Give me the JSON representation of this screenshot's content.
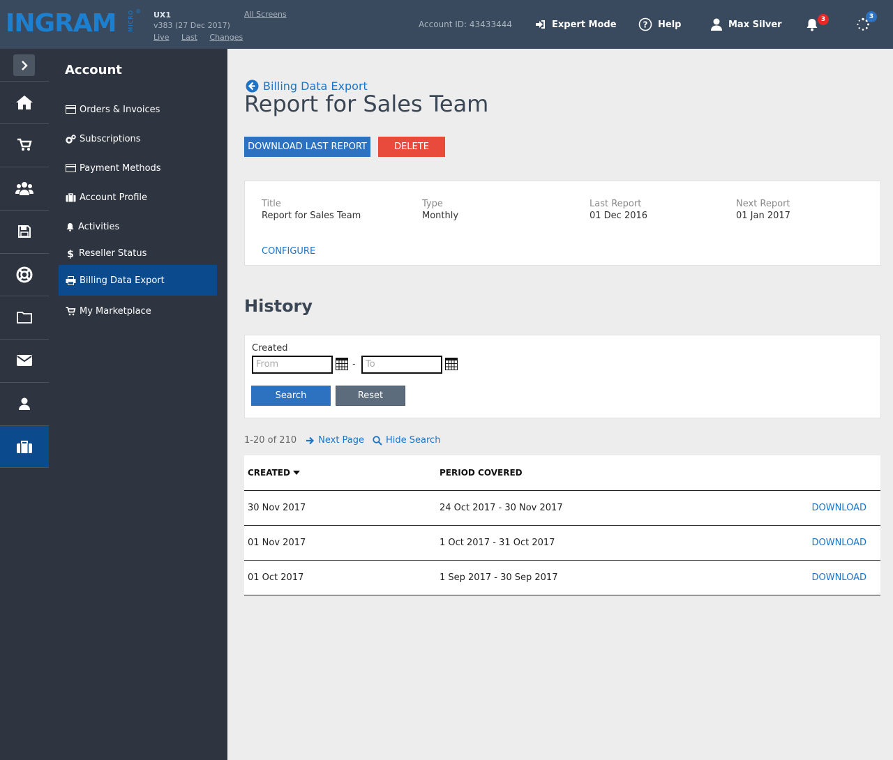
{
  "header": {
    "logo_text": "INGRAM",
    "logo_micro": "MICRO",
    "logo_reg": "®",
    "app_name": "UX1",
    "version": "v383 (27 Dec 2017)",
    "links": [
      "Live",
      "Last",
      "Changes"
    ],
    "all_screens": "All Screens",
    "account_id": "Account ID: 43433444",
    "expert_mode": "Expert Mode",
    "help": "Help",
    "user_name": "Max Silver",
    "notifications_count": "3",
    "tasks_count": "3"
  },
  "rail": {
    "items": [
      "home-icon",
      "cart-icon",
      "users-icon",
      "save-icon",
      "support-icon",
      "folder-icon",
      "mail-icon",
      "user-icon",
      "briefcase-icon"
    ],
    "active_index": 8
  },
  "sidenav": {
    "title": "Account",
    "items": [
      {
        "label": "Orders & Invoices",
        "icon": "card-icon"
      },
      {
        "label": "Subscriptions",
        "icon": "gears-icon"
      },
      {
        "label": "Payment Methods",
        "icon": "card-icon"
      },
      {
        "label": "Account Profile",
        "icon": "briefcase-icon"
      },
      {
        "label": "Activities",
        "icon": "bell-icon"
      },
      {
        "label": "Reseller Status",
        "icon": "dollar-icon"
      },
      {
        "label": "Billing Data Export",
        "icon": "printer-icon",
        "active": true
      },
      {
        "label": "My Marketplace",
        "icon": "cart-icon"
      }
    ]
  },
  "main": {
    "back_label": "Billing Data Export",
    "title": "Report for Sales Team",
    "download_last": "DOWNLOAD LAST REPORT",
    "delete": "DELETE",
    "details": {
      "title_label": "Title",
      "title_value": "Report for Sales Team",
      "type_label": "Type",
      "type_value": "Monthly",
      "last_label": "Last Report",
      "last_value": "01 Dec 2016",
      "next_label": "Next Report",
      "next_value": "01 Jan 2017",
      "configure": "CONFIGURE"
    },
    "history": {
      "title": "History",
      "created_label": "Created",
      "from_placeholder": "From",
      "to_placeholder": "To",
      "dash": "-",
      "search": "Search",
      "reset": "Reset",
      "pager_count": "1-20 of 210",
      "next_page": "Next Page",
      "hide_search": "Hide Search",
      "columns": [
        "CREATED",
        "PERIOD COVERED"
      ],
      "rows": [
        {
          "created": "30 Nov 2017",
          "period": "24 Oct 2017 - 30 Nov 2017",
          "action": "DOWNLOAD"
        },
        {
          "created": "01 Nov 2017",
          "period": "1 Oct 2017 - 31 Oct 2017",
          "action": "DOWNLOAD"
        },
        {
          "created": "01 Oct 2017",
          "period": "1 Sep 2017 - 30 Sep 2017",
          "action": "DOWNLOAD"
        }
      ]
    }
  },
  "colors": {
    "topbar": "#3a4a5e",
    "sidebar": "#2e3540",
    "active": "#0b4a8c",
    "primary": "#2c72c1",
    "danger": "#e84a3c",
    "link": "#1b74c8"
  }
}
